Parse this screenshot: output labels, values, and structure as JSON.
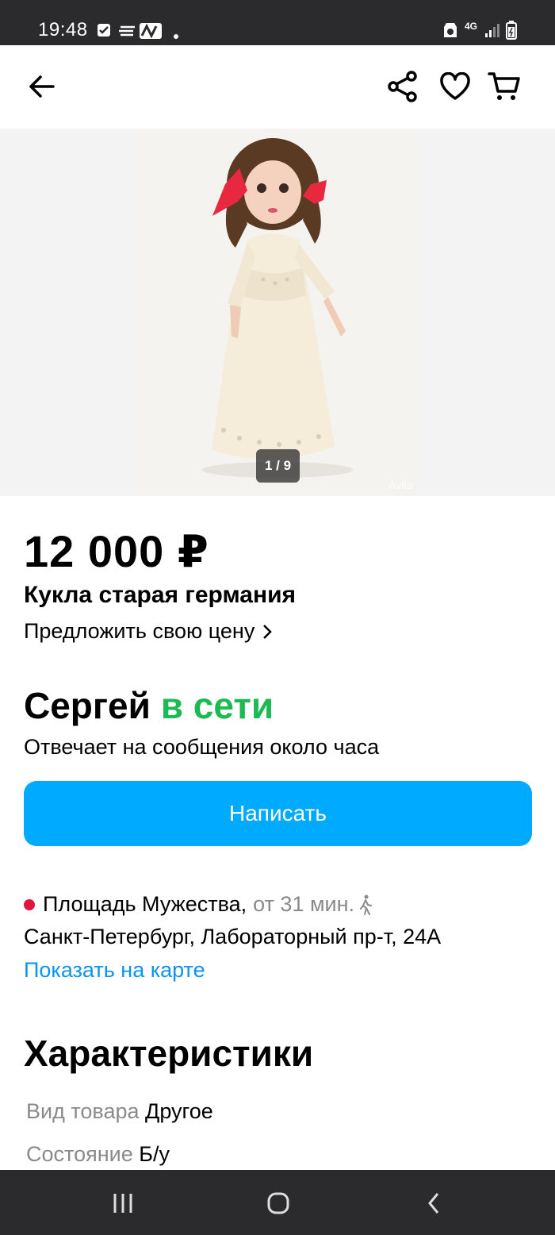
{
  "status": {
    "time": "19:48",
    "network": "4G"
  },
  "gallery": {
    "counter": "1 / 9",
    "watermark": "Avito"
  },
  "listing": {
    "price": "12 000 ₽",
    "title": "Кукла старая германия",
    "offer_label": "Предложить свою цену"
  },
  "seller": {
    "name": "Сергей",
    "online": "в сети",
    "responds": "Отвечает на сообщения около часа",
    "write_button": "Написать"
  },
  "location": {
    "metro": "Площадь Мужества,",
    "distance": "от 31 мин.",
    "address": "Санкт-Петербург, Лабораторный пр-т, 24А",
    "map_link": "Показать на карте"
  },
  "characteristics": {
    "heading": "Характеристики",
    "items": [
      {
        "key": "Вид товара",
        "value": "Другое"
      },
      {
        "key": "Состояние",
        "value": "Б/у"
      }
    ]
  },
  "colors": {
    "accent": "#00aaff",
    "online": "#1db954",
    "metro": "#e0143c",
    "link": "#0a94f0"
  }
}
